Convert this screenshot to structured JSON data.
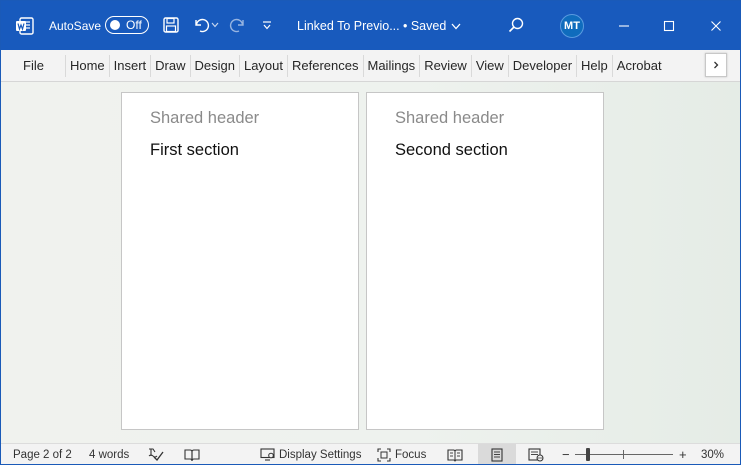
{
  "titlebar": {
    "autosave_label": "AutoSave",
    "autosave_state": "Off",
    "document_title": "Linked To Previo...",
    "save_status": "• Saved",
    "user_initials": "MT",
    "accent_color": "#185abd"
  },
  "ribbon": {
    "tabs": [
      "File",
      "Home",
      "Insert",
      "Draw",
      "Design",
      "Layout",
      "References",
      "Mailings",
      "Review",
      "View",
      "Developer",
      "Help",
      "Acrobat"
    ],
    "more_icon": "chevron-right-icon"
  },
  "pages": [
    {
      "header": "Shared header",
      "body": "First section"
    },
    {
      "header": "Shared header",
      "body": "Second section"
    }
  ],
  "statusbar": {
    "page_info": "Page 2 of 2",
    "word_count": "4 words",
    "display_settings": "Display Settings",
    "focus": "Focus",
    "zoom_minus": "−",
    "zoom_plus": "+",
    "zoom_level": "30%",
    "zoom_percent": 30
  }
}
